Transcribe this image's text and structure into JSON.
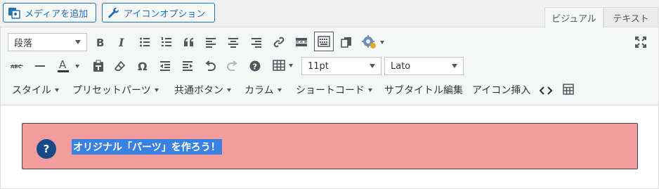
{
  "media_buttons": {
    "add_media": "メディアを追加",
    "icon_options": "アイコンオプション"
  },
  "tabs": [
    "ビジュアル",
    "テキスト"
  ],
  "toolbar": {
    "row1": {
      "format_select": "段落",
      "icons": [
        "bold-icon",
        "italic-icon",
        "bullet-list-icon",
        "numbered-list-icon",
        "blockquote-icon",
        "align-left-icon",
        "align-center-icon",
        "align-right-icon",
        "link-icon",
        "read-more-icon",
        "toolbar-toggle-icon",
        "copy-icon",
        "settings-gear-icon",
        "fullscreen-icon"
      ]
    },
    "row2": {
      "font_size": "11pt",
      "font_family": "Lato",
      "icons": [
        "strikethrough-icon",
        "horizontal-line-icon",
        "text-color-icon",
        "paste-text-icon",
        "clear-formatting-icon",
        "omega-icon",
        "outdent-icon",
        "indent-icon",
        "undo-icon",
        "redo-icon",
        "help-icon",
        "table-icon"
      ]
    },
    "row3": {
      "menus": [
        "スタイル",
        "プリセットパーツ",
        "共通ボタン",
        "カラム",
        "ショートコード"
      ],
      "plain_items": [
        "サブタイトル編集",
        "アイコン挿入"
      ]
    }
  },
  "content": {
    "alert_icon": "?",
    "selected_text": "オリジナル「パーツ」を作ろう！"
  },
  "colors": {
    "accent": "#2271b1",
    "alert_bg": "#f29c9e",
    "alert_border": "#36495a",
    "icon_bg": "#174a86",
    "selection": "#3b82e0"
  }
}
